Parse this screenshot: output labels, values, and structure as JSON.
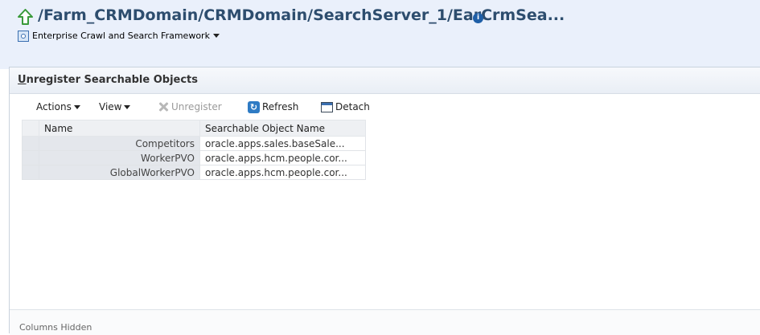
{
  "header": {
    "title": "/Farm_CRMDomain/CRMDomain/SearchServer_1/EarCrmSea...",
    "info_glyph": "i",
    "target_type_label": "Enterprise Crawl and Search Framework"
  },
  "panel": {
    "title_first_letter": "U",
    "title_rest": "nregister Searchable Objects"
  },
  "toolbar": {
    "actions_label": "Actions",
    "view_label": "View",
    "unregister_label": "Unregister",
    "refresh_label": "Refresh",
    "detach_label": "Detach"
  },
  "table": {
    "columns": [
      "Name",
      "Searchable Object Name"
    ],
    "rows": [
      {
        "name": "Competitors",
        "object": "oracle.apps.sales.baseSale..."
      },
      {
        "name": "WorkerPVO",
        "object": "oracle.apps.hcm.people.cor..."
      },
      {
        "name": "GlobalWorkerPVO",
        "object": "oracle.apps.hcm.people.cor..."
      }
    ]
  },
  "footer": {
    "status": "Columns Hidden"
  },
  "colors": {
    "header_bg": "#eaf0fb",
    "title_color": "#2d4d6e",
    "up_arrow": "#3a9a3a"
  }
}
